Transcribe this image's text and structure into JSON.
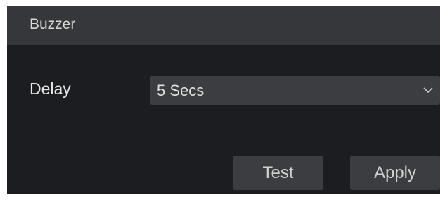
{
  "header": {
    "title": "Buzzer"
  },
  "form": {
    "delay_label": "Delay",
    "delay_value": "5 Secs",
    "delay_icon": "chevron-down-icon"
  },
  "actions": {
    "test_label": "Test",
    "apply_label": "Apply"
  },
  "colors": {
    "panel_bg": "#1c1d21",
    "header_bg": "#36373b",
    "control_bg": "#3c3d41",
    "text": "#e0e0e0"
  }
}
